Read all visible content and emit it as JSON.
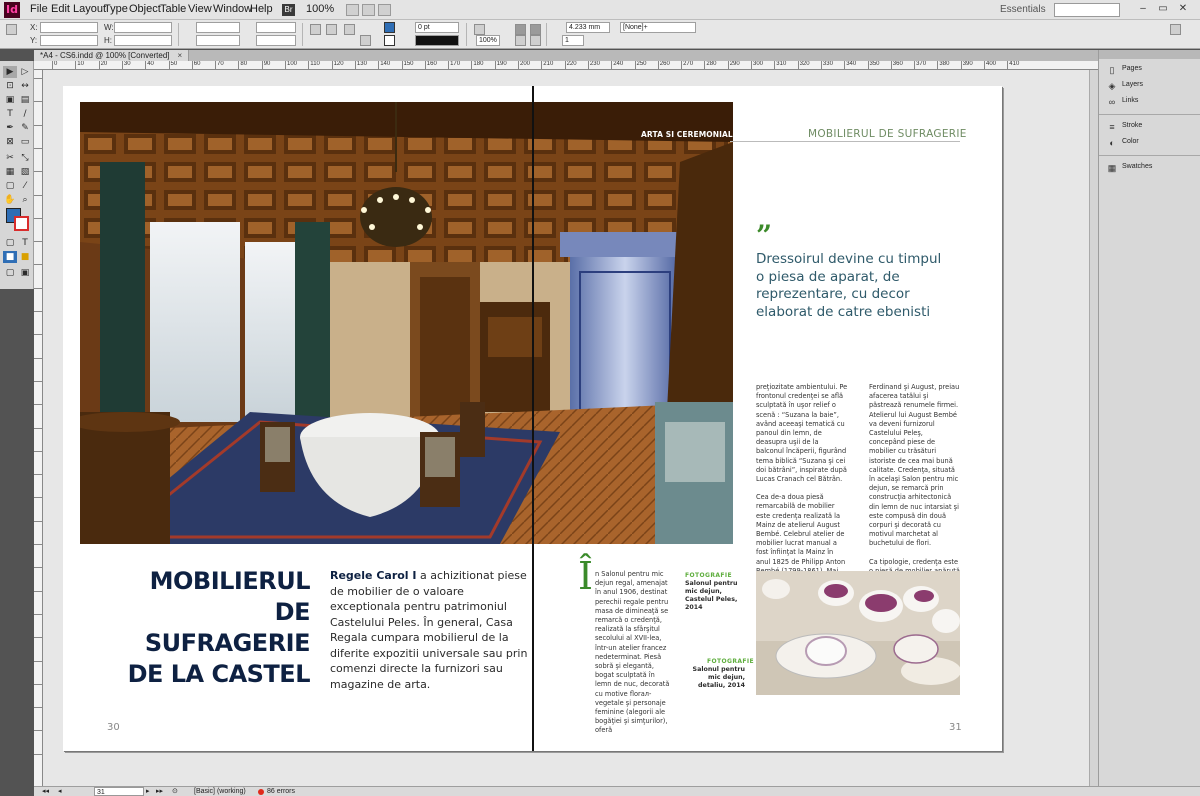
{
  "app": {
    "logo_text": "Id",
    "workspace": "Essentials",
    "zoom": "100%"
  },
  "menu": [
    "File",
    "Edit",
    "Layout",
    "Type",
    "Object",
    "Table",
    "View",
    "Window",
    "Help"
  ],
  "control_panel": {
    "x_label": "X:",
    "y_label": "Y:",
    "w_label": "W:",
    "h_label": "H:",
    "stroke_weight": "0 pt",
    "scale": "100%",
    "dimension": "4.233 mm",
    "style": "[None]+",
    "count": "1"
  },
  "document": {
    "tab_title": "*A4 - CS6.indd @ 100% [Converted]",
    "close": "×"
  },
  "ruler": {
    "marks": [
      "0",
      "10",
      "20",
      "30",
      "40",
      "50",
      "60",
      "70",
      "80",
      "90",
      "100",
      "110",
      "120",
      "130",
      "140",
      "150",
      "160",
      "170",
      "180",
      "190",
      "200",
      "210",
      "220",
      "230",
      "240",
      "250",
      "260",
      "270",
      "280",
      "290",
      "300",
      "310",
      "320",
      "330",
      "340",
      "350",
      "360",
      "370",
      "380",
      "390",
      "400",
      "410"
    ]
  },
  "tools": [
    "▸",
    "▹",
    "⟷",
    "↔",
    "⊞",
    "⊟",
    "T",
    "/",
    "✎",
    "✐",
    "⊠",
    "▭",
    "✂",
    "⟳",
    "▦",
    "▤",
    "✋",
    "🔍"
  ],
  "spread": {
    "left_page": {
      "headline": [
        "MOBILIERUL",
        "DE SUFRAGERIE",
        "DE LA CASTEL"
      ],
      "intro_lead": "Regele Carol I",
      "intro_rest": " a achizitionat piese de mobilier de o valoare exceptionala pentru patrimoniul Castelului Peles. În general, Casa Regala cumpara mobilierul de la diferite expozitii universale sau prin comenzi directe la furnizori sau magazine de arta.",
      "page_number": "30"
    },
    "right_page": {
      "kicker_bold": "ARTA SI CEREMONIAL LA MESELE REGALE",
      "kicker_light": "MOBILIERUL DE SUFRAGERIE",
      "quote_mark": "”",
      "pullquote": "Dressoirul devine cu timpul o piesa de aparat, de reprezentare, cu decor elaborat de catre ebenisti",
      "col1": [
        "preţiozitate ambientului. Pe frontonul credenţei se află sculptată în uşor relief o scenă : “Suzana la baie”, având aceeaşi tematică cu panoul din lemn, de deasupra uşii de la balconul încăperii, figurând tema biblică “Suzana şi cei doi bătrâni”, inspirate după Lucas Cranach cel Bătrân.",
        "Cea de-a doua piesă remarcabilă de mobilier este credenţa realizată la Mainz de atelierul August Bembé. Celebrul atelier de mobilier lucrat manual a fost înfiinţat la Mainz în anul 1825 de Philipp Anton Bembé (1799-1861). Mai târziu, cei doi fii, Christian"
      ],
      "col2": [
        "Ferdinand şi August, preiau afacerea tatălui şi păstrează renumele firmei. Atelierul lui August Bembé va deveni furnizorul Castelului Peleş, concepând piese de mobilier cu trăsături istoriste de cea mai bună calitate. Credenţa, situată în acelaşi Salon pentru mic dejun, se remarcă prin construcţia arhitectonică din lemn de nuc intarsiat şi este compusă din două corpuri şi decorată cu  motivul marchetat al buchetului de flori.",
        "Ca tipologie, credenţa este o piesă de mobilier apărută în perioada Evului Mediu, formată dintr-un corp cu uşi, aşezat"
      ],
      "dropcap": "Î",
      "col3_first": "n Salonul pentru mic dejun regal, amenajat în anul 1906, destinat perechii regale pentru masa de dimineaţă se remarcă o credenţă, realizată la sfârşitul secolului al XVII-lea, într-un atelier francez nedeterminat. Piesă sobră şi elegantă, bogat sculptată în lemn de nuc, decorată cu motive florал-vegetale şi personaje feminine (alegorii ale bogăţiei şi simţurilor), oferă",
      "caption1_title": "FOTOGRAFIE",
      "caption1_text": "Salonul pentru mic dejun, Castelul Peles, 2014",
      "caption2_title": "FOTOGRAFIE",
      "caption2_text": "Salonul pentru mic dejun, detaliu, 2014",
      "page_number": "31"
    }
  },
  "panels": [
    "Pages",
    "Layers",
    "Links",
    "Stroke",
    "Color",
    "Swatches"
  ],
  "status": {
    "page": "31",
    "style": "[Basic] (working)",
    "errors": "86 errors"
  },
  "colors": {
    "accent_green": "#3c8a2a",
    "headline_navy": "#0e2142",
    "fill": "#2f6eb5",
    "stroke": "#d92c2c"
  }
}
